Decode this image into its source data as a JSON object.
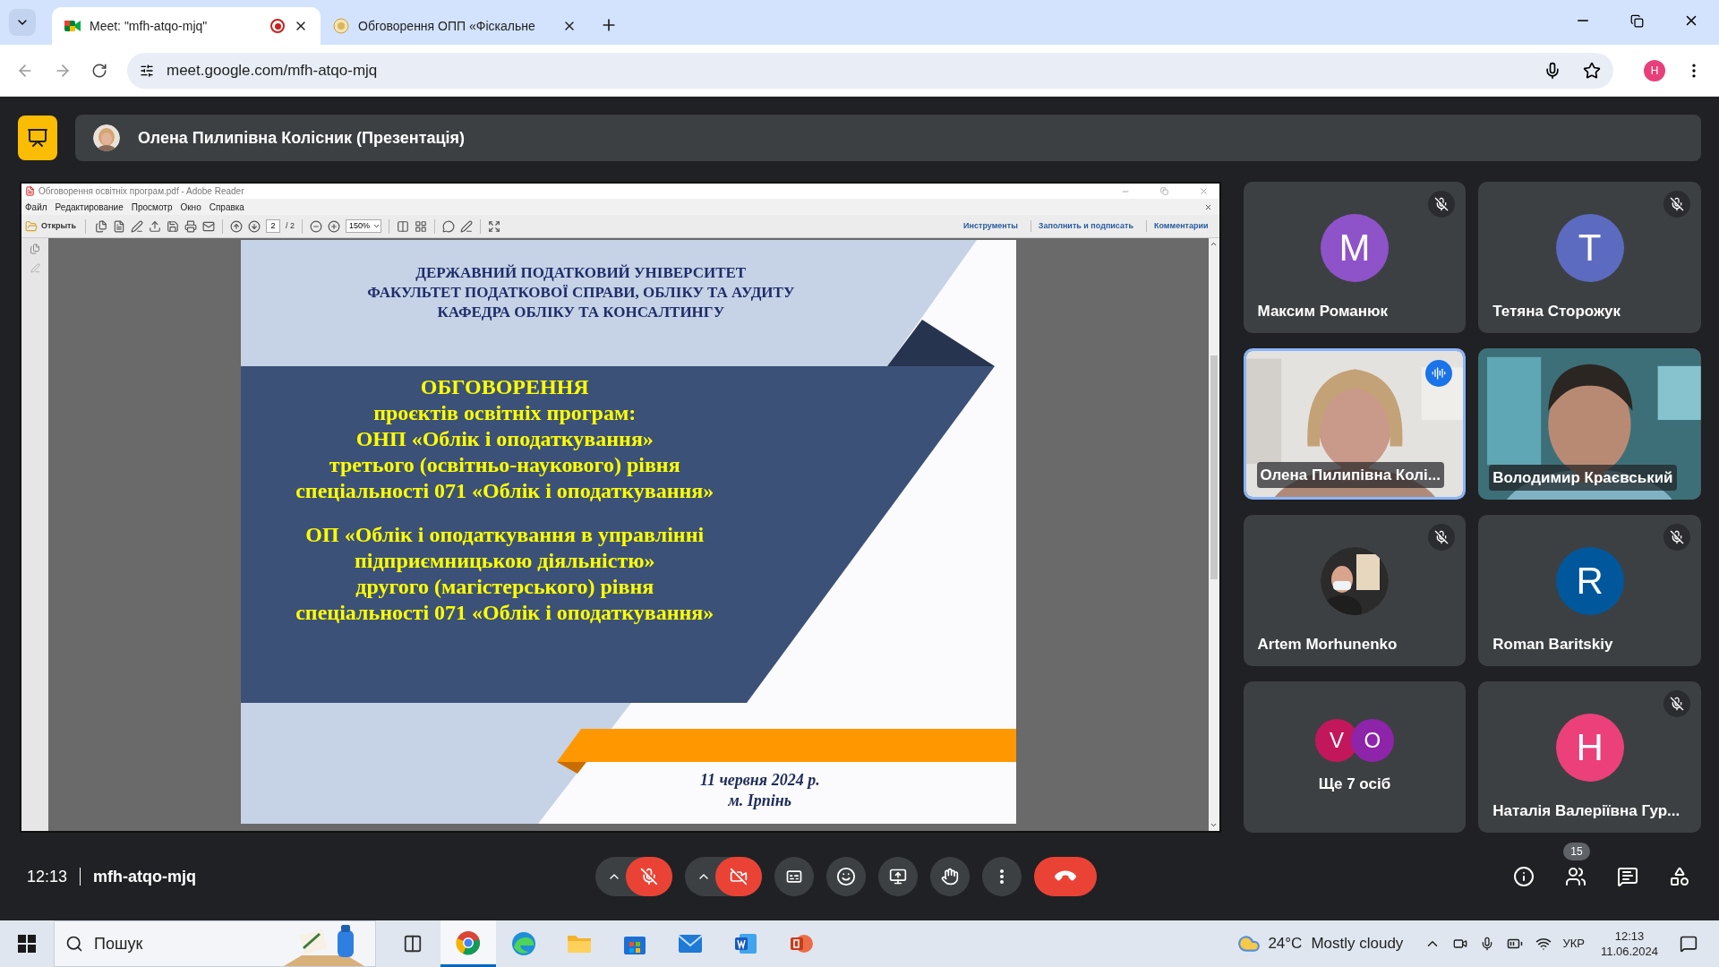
{
  "browser": {
    "tabs": [
      {
        "kind": "meet",
        "title": "Meet: \"mfh-atqo-mjq\"",
        "selected": true,
        "recording": true
      },
      {
        "kind": "emblem",
        "title": "Обговорення ОПП «Фіскальне",
        "selected": false,
        "recording": false
      }
    ],
    "url": "meet.google.com/mfh-atqo-mjq",
    "profile": "H"
  },
  "presenter_bar": {
    "title": "Олена Пилипівна Колісник (Презентація)"
  },
  "reader": {
    "title": "Обговорення освітніх програм.pdf - Adobe Reader",
    "menu": [
      "Файл",
      "Редактирование",
      "Просмотр",
      "Окно",
      "Справка"
    ],
    "open_label": "Открыть",
    "page": "2",
    "page_total": "/ 2",
    "zoom": "150%",
    "panels": [
      "Инструменты",
      "Заполнить и подписать",
      "Комментарии"
    ]
  },
  "slide": {
    "header_lines": [
      "ДЕРЖАВНИЙ ПОДАТКОВИЙ УНІВЕРСИТЕТ",
      "ФАКУЛЬТЕТ ПОДАТКОВОЇ СПРАВИ, ОБЛІКУ ТА АУДИТУ",
      "КАФЕДРА ОБЛІКУ ТА КОНСАЛТИНГУ"
    ],
    "title_blocks": [
      [
        "ОБГОВОРЕННЯ",
        "проєктів освітніх програм:",
        "ОНП «Облік і оподаткування»",
        "третього (освітньо-наукового) рівня",
        "спеціальності 071 «Облік і оподаткування»"
      ],
      [
        "ОП «Облік і оподаткування в управлінні",
        "підприємницькою діяльністю»",
        "другого (магістерського) рівня",
        "спеціальності 071 «Облік і оподаткування»"
      ]
    ],
    "date_lines": [
      "11 червня 2024 р.",
      "м. Ірпінь"
    ]
  },
  "tiles": [
    {
      "kind": "letter",
      "name": "Максим Романюк",
      "letter": "M",
      "color": "#8e52c9",
      "muted": true,
      "speaking": false
    },
    {
      "kind": "letter",
      "name": "Тетяна Сторожук",
      "letter": "T",
      "color": "#5c6bc0",
      "muted": true,
      "speaking": false
    },
    {
      "kind": "video",
      "name": "Олена Пилипівна Колі...",
      "muted": false,
      "speaking": true
    },
    {
      "kind": "video",
      "name": "Володимир Краєвський",
      "muted": false,
      "speaking": false
    },
    {
      "name": "Artem Morhunenko",
      "muted": true,
      "speaking": false
    },
    {
      "kind": "letter",
      "name": "Roman Baritskiy",
      "letter": "R",
      "color": "#01579b",
      "muted": true,
      "speaking": false
    },
    {
      "kind": "group",
      "name": "Ще 7 осіб",
      "avatars": [
        {
          "letter": "V",
          "color": "#c2185b"
        },
        {
          "letter": "O",
          "color": "#8e24aa"
        }
      ],
      "muted": false,
      "speaking": false
    },
    {
      "kind": "letter",
      "name": "Наталія Валеріївна Гур...",
      "letter": "H",
      "color": "#ec407a",
      "muted": true,
      "speaking": false
    }
  ],
  "meeting_bar": {
    "time": "12:13",
    "code": "mfh-atqo-mjq",
    "controls": [
      {
        "kind": "mic",
        "on": false
      },
      {
        "kind": "camera",
        "on": false
      },
      {
        "kind": "captions",
        "on": false
      },
      {
        "kind": "reactions"
      },
      {
        "kind": "present"
      },
      {
        "kind": "hand"
      },
      {
        "kind": "more"
      },
      {
        "kind": "leave"
      }
    ],
    "people_count": "15"
  },
  "taskbar": {
    "search_placeholder": "Пошук",
    "apps": [
      {
        "kind": "taskview",
        "selected": false
      },
      {
        "kind": "chrome",
        "selected": true
      },
      {
        "kind": "edge",
        "selected": false
      },
      {
        "kind": "folder",
        "selected": false
      },
      {
        "kind": "store",
        "selected": false
      },
      {
        "kind": "mail",
        "selected": false
      },
      {
        "kind": "word",
        "selected": false
      },
      {
        "kind": "powerpoint",
        "selected": false
      }
    ],
    "temperature": "24°C",
    "weather": "Mostly cloudy",
    "language": "УКР",
    "time": "12:13",
    "date": "11.06.2024"
  }
}
